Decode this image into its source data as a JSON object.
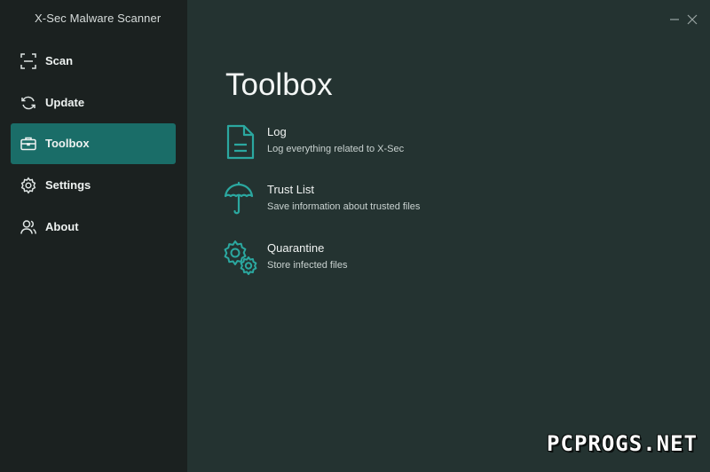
{
  "app": {
    "title": "X-Sec Malware Scanner"
  },
  "sidebar": {
    "items": [
      {
        "label": "Scan",
        "icon": "scan-icon",
        "active": false
      },
      {
        "label": "Update",
        "icon": "refresh-icon",
        "active": false
      },
      {
        "label": "Toolbox",
        "icon": "toolbox-icon",
        "active": true
      },
      {
        "label": "Settings",
        "icon": "gear-icon",
        "active": false
      },
      {
        "label": "About",
        "icon": "users-icon",
        "active": false
      }
    ]
  },
  "main": {
    "title": "Toolbox",
    "tools": [
      {
        "name": "Log",
        "description": "Log everything related to X-Sec",
        "icon": "document-icon"
      },
      {
        "name": "Trust List",
        "description": "Save information about trusted files",
        "icon": "umbrella-icon"
      },
      {
        "name": "Quarantine",
        "description": "Store infected files",
        "icon": "quarantine-gears-icon"
      }
    ]
  },
  "window_controls": {
    "minimize_icon": "minimize-icon",
    "close_icon": "close-icon"
  },
  "watermark": {
    "text": "PCPROGS.NET"
  },
  "colors": {
    "sidebar_bg": "#1b2120",
    "main_bg": "#243331",
    "accent": "#1a6d68",
    "icon_accent": "#2ba8a0"
  }
}
